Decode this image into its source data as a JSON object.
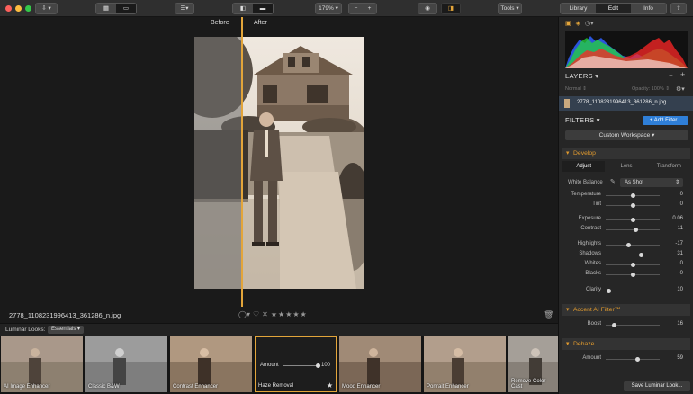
{
  "toolbar": {
    "zoom": "179%",
    "tools_label": "Tools",
    "tabs": [
      "Library",
      "Edit",
      "Info"
    ],
    "active_tab": "Edit"
  },
  "canvas": {
    "before_label": "Before",
    "after_label": "After",
    "filename": "2778_1108231996413_361286_n.jpg"
  },
  "looks": {
    "label": "Luminar Looks:",
    "category": "Essentials",
    "items": [
      "AI Image Enhancer",
      "Classic B&W",
      "Contrast Enhancer",
      "Haze Removal",
      "Mood Enhancer",
      "Portrait Enhancer",
      "Remove Color Cast"
    ],
    "selected_amount_label": "Amount",
    "selected_amount": "100",
    "save_button": "Save Luminar Look..."
  },
  "layers": {
    "title": "LAYERS",
    "blend_mode": "Normal",
    "opacity_label": "Opacity:",
    "opacity": "100%",
    "layer_name": "2778_1108231996413_361286_n.jpg"
  },
  "filters": {
    "title": "FILTERS",
    "add_button": "+ Add Filter...",
    "workspace": "Custom Workspace",
    "develop": {
      "title": "Develop",
      "tabs": [
        "Adjust",
        "Lens",
        "Transform"
      ],
      "white_balance_label": "White Balance",
      "white_balance_value": "As Shot",
      "sliders": [
        {
          "label": "Temperature",
          "value": "0",
          "pos": 0.5
        },
        {
          "label": "Tint",
          "value": "0",
          "pos": 0.5
        },
        {
          "label": "Exposure",
          "value": "0.06",
          "pos": 0.51
        },
        {
          "label": "Contrast",
          "value": "11",
          "pos": 0.55
        },
        {
          "label": "Highlights",
          "value": "-17",
          "pos": 0.42
        },
        {
          "label": "Shadows",
          "value": "31",
          "pos": 0.65
        },
        {
          "label": "Whites",
          "value": "0",
          "pos": 0.5
        },
        {
          "label": "Blacks",
          "value": "0",
          "pos": 0.5
        },
        {
          "label": "Clarity",
          "value": "10",
          "pos": 0.05
        }
      ]
    },
    "accent": {
      "title": "Accent AI Filter™",
      "boost_label": "Boost",
      "boost_value": "16",
      "boost_pos": 0.16
    },
    "dehaze": {
      "title": "Dehaze",
      "amount_label": "Amount",
      "amount_value": "59",
      "amount_pos": 0.59
    }
  },
  "colors": {
    "accent": "#e3a53a",
    "filter_header": "#e09a2e",
    "add_filter_button": "#2f7fd8"
  }
}
